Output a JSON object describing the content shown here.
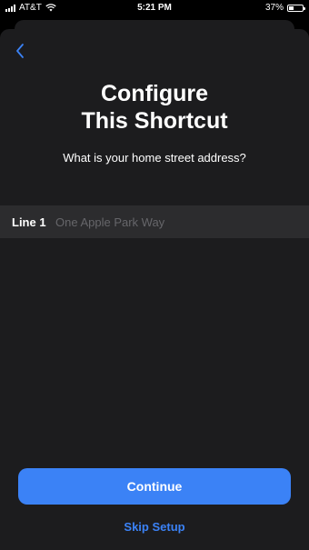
{
  "status_bar": {
    "carrier": "AT&T",
    "time": "5:21 PM",
    "battery_percent": "37%",
    "battery_level": 0.37,
    "icons": [
      "signal-icon",
      "wifi-icon",
      "battery-icon"
    ]
  },
  "sheet": {
    "back_icon": "chevron-left-icon",
    "title_line1": "Configure",
    "title_line2": "This Shortcut",
    "question": "What is your home street address?",
    "field": {
      "label": "Line 1",
      "value": "",
      "placeholder": "One Apple Park Way"
    },
    "continue_label": "Continue",
    "skip_label": "Skip Setup"
  },
  "colors": {
    "accent": "#3b82f6",
    "sheet_bg": "#1c1c1e",
    "field_bg": "#2c2c2e"
  }
}
